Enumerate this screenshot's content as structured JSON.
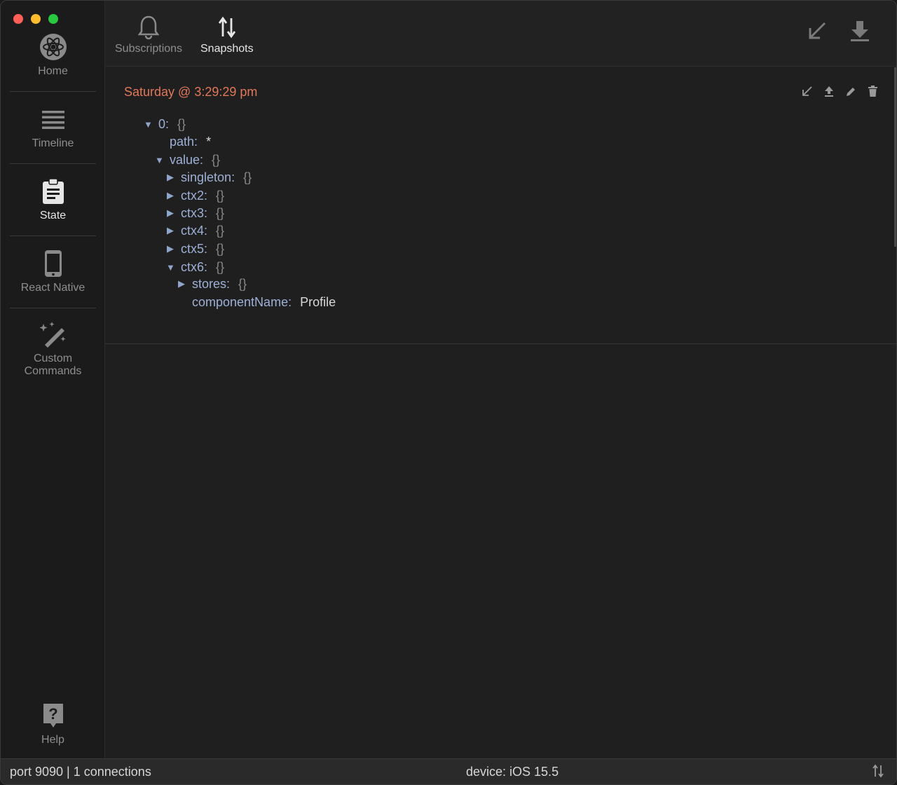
{
  "sidebar": {
    "items": [
      {
        "label": "Home",
        "icon": "reactotron-logo-icon"
      },
      {
        "label": "Timeline",
        "icon": "list-lines-icon"
      },
      {
        "label": "State",
        "icon": "clipboard-icon"
      },
      {
        "label": "React Native",
        "icon": "phone-icon"
      },
      {
        "label": "Custom",
        "label2": "Commands",
        "icon": "magic-wand-icon"
      }
    ],
    "help": {
      "label": "Help",
      "icon": "help-icon"
    }
  },
  "tabs": [
    {
      "label": "Subscriptions",
      "icon": "bell-icon"
    },
    {
      "label": "Snapshots",
      "icon": "up-down-arrows-icon"
    }
  ],
  "snapshot": {
    "title": "Saturday @ 3:29:29 pm",
    "tree": {
      "root_key": "0",
      "path_key": "path",
      "path_val": "*",
      "value_key": "value",
      "singleton_key": "singleton",
      "ctx2_key": "ctx2",
      "ctx3_key": "ctx3",
      "ctx4_key": "ctx4",
      "ctx5_key": "ctx5",
      "ctx6_key": "ctx6",
      "stores_key": "stores",
      "component_key": "componentName",
      "component_val": "Profile",
      "obj": "{}"
    }
  },
  "status": {
    "left": "port 9090 | 1 connections",
    "center": "device: iOS 15.5"
  },
  "colors": {
    "accent_title": "#e2775a",
    "key_blue": "#9db0d6"
  }
}
